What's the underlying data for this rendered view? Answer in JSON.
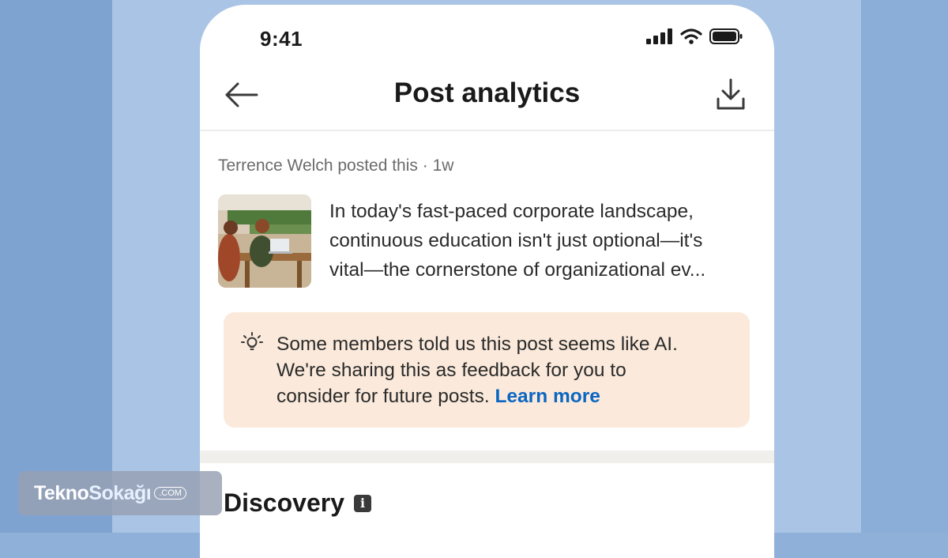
{
  "status_bar": {
    "time": "9:41"
  },
  "header": {
    "title": "Post analytics"
  },
  "post": {
    "author_line": "Terrence Welch posted this",
    "separator": "·",
    "age": "1w",
    "text_lines": [
      "In today's fast-paced corporate landscape,",
      "continuous education isn't just optional—it's",
      "vital—the cornerstone of organizational ev..."
    ]
  },
  "ai_notice": {
    "icon": "lightbulb-icon",
    "lines": [
      "Some members told us this post seems like AI.",
      "We're sharing this as feedback for you to",
      "consider for future posts."
    ],
    "link": "Learn more"
  },
  "discovery": {
    "title": "Discovery",
    "icon": "info-icon"
  },
  "watermark": {
    "brand_a": "Tekno",
    "brand_b": "Sokağı",
    "tld": ".COM"
  },
  "colors": {
    "link": "#0a66c2",
    "notice_bg": "#fbeadb",
    "page_bg": "#a9c4e4"
  }
}
